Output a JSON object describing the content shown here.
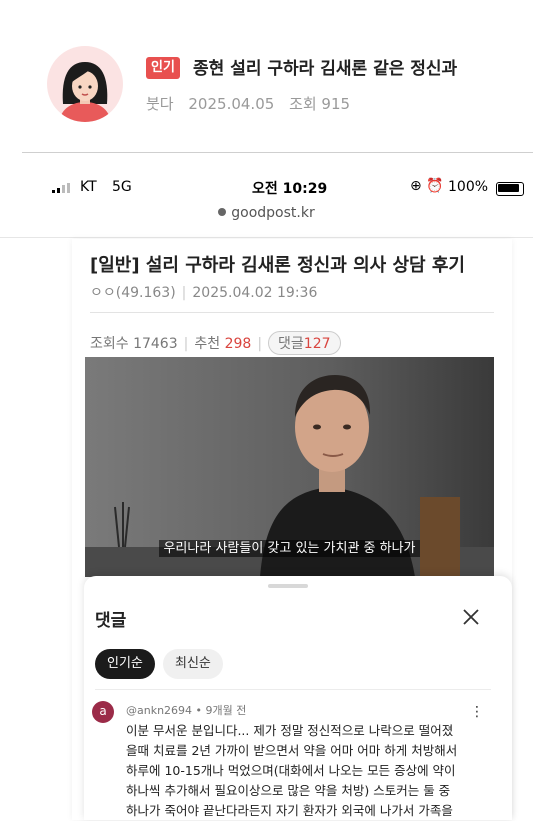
{
  "post": {
    "badge": "인기",
    "title": "종현 설리 구하라 김새론 같은 정신과",
    "author": "붓다",
    "date": "2025.04.05",
    "views": "조회 915"
  },
  "statusbar": {
    "carrier": "KT",
    "network": "5G",
    "time": "오전 10:29",
    "battery": "100%"
  },
  "browser": {
    "url": "goodpost.kr"
  },
  "article": {
    "title": "[일반] 설리 구하라 김새론 정신과 의사 상담 후기",
    "author": "ㅇㅇ(49.163)",
    "datetime": "2025.04.02 19:36",
    "views_label": "조회수 17463",
    "recommend_label": "추천",
    "recommend_count": "298",
    "comments_label": "댓글",
    "comments_count": "127"
  },
  "video": {
    "subtitle": "우리나라 사람들이 갖고 있는 가치관 중 하나가"
  },
  "comments_sheet": {
    "title": "댓글",
    "tabs": [
      {
        "label": "인기순",
        "active": true
      },
      {
        "label": "최신순",
        "active": false
      }
    ],
    "comment": {
      "avatar_letter": "a",
      "user": "@ankn2694",
      "time": "9개월 전",
      "lines": [
        "이분 무서운 분입니다... 제가 정말 정신적으로 나락으로 떨어졌",
        "을때 치료를 2년 가까이 받으면서 약을 어마 어마 하게 처방해서",
        "하루에 10-15개나 먹었으며(대화에서 나오는 모든 증상에 약이",
        "하나씩 추가해서 필요이상으로 많은 약을 처방) 스토커는 둘 중",
        "하나가 죽어야 끝난다라든지 자기 환자가 외국에 나가서 가족을"
      ]
    }
  },
  "colors": {
    "badge": "#e8504f",
    "accent_red": "#d9453f",
    "tab_active": "#1b1b1b",
    "avatar_comment": "#9b2b48"
  }
}
